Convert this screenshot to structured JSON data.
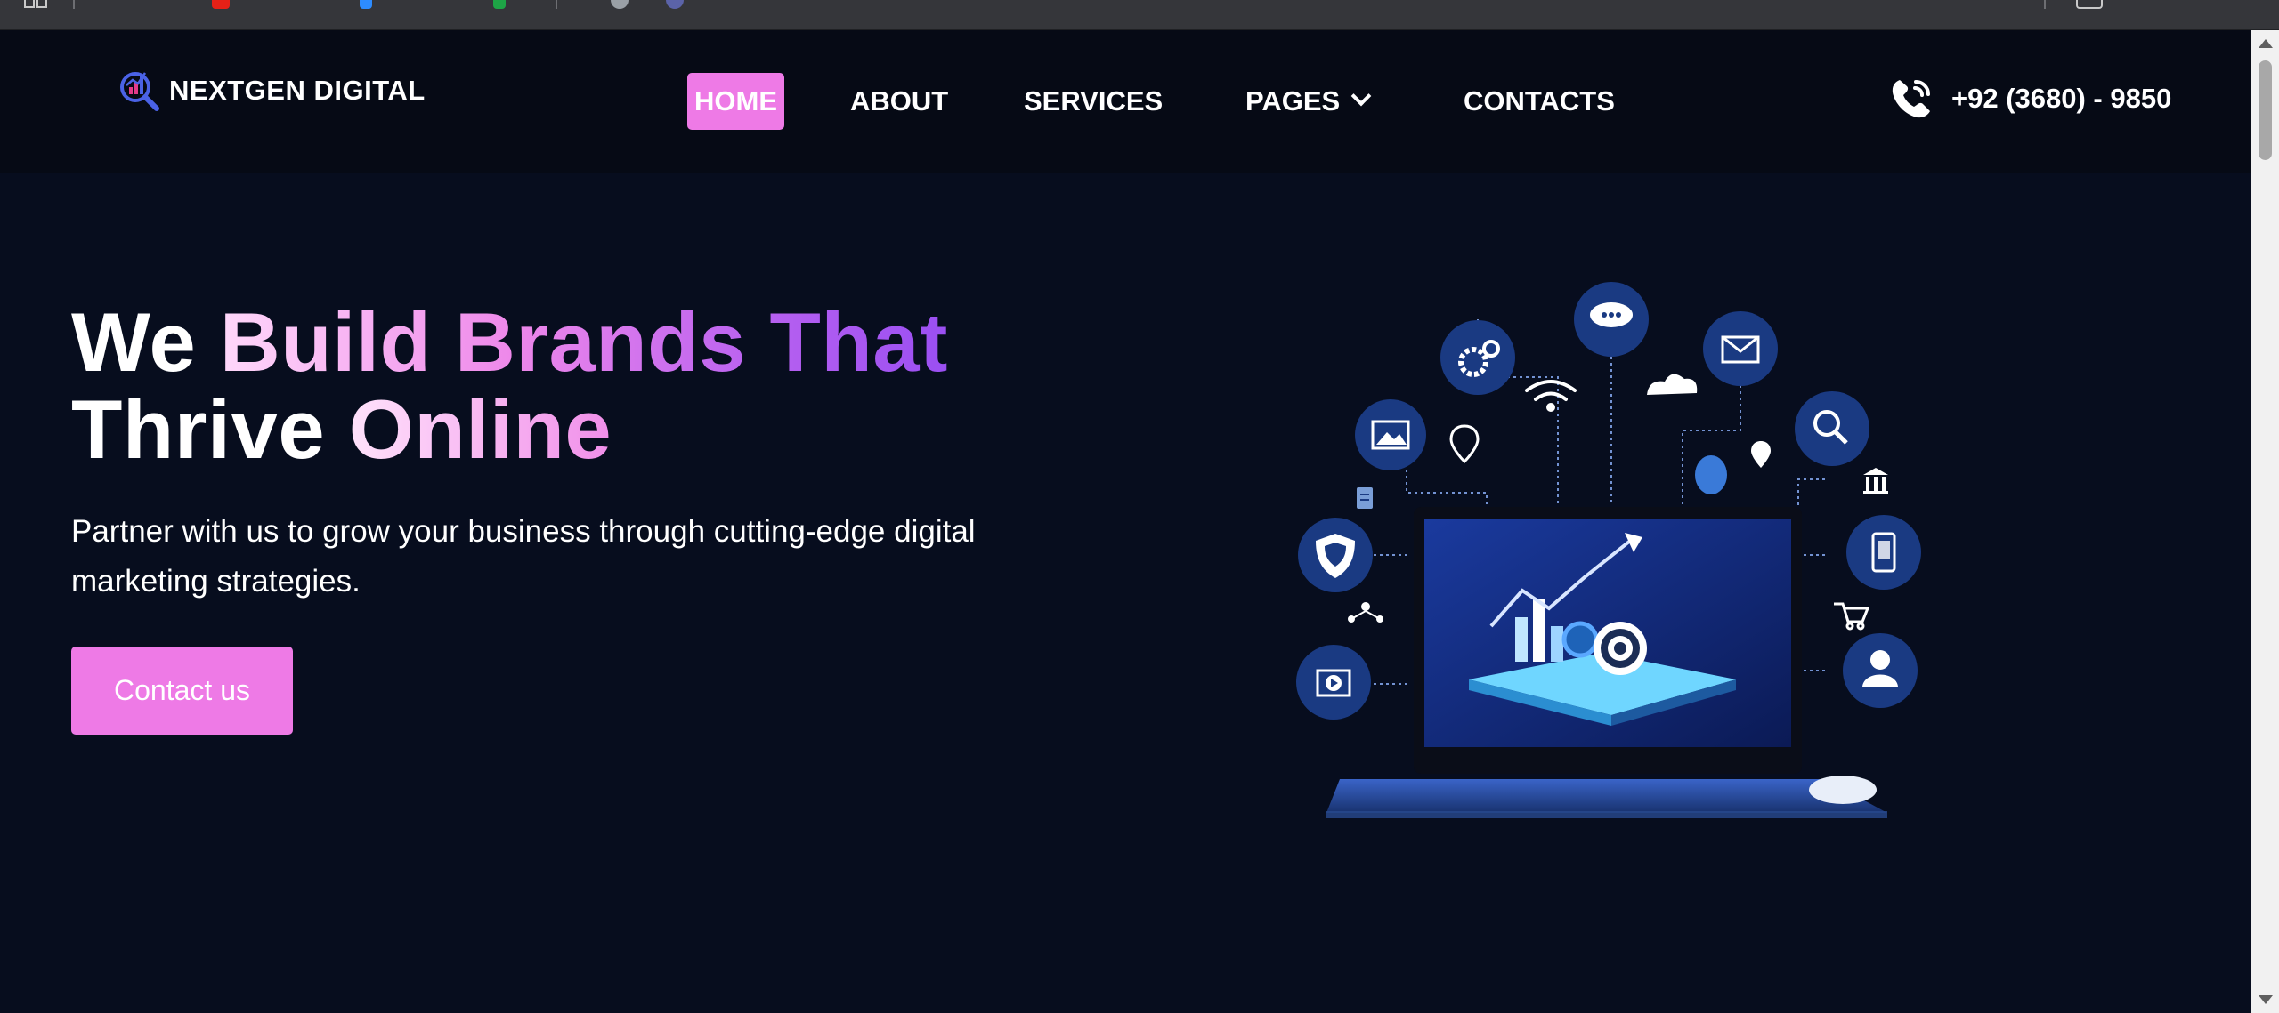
{
  "brand": {
    "name": "NEXTGEN DIGITAL",
    "accent": "#ee7ae6",
    "background": "#070d1e",
    "nav_background": "#060a15"
  },
  "nav": {
    "items": [
      {
        "label": "HOME",
        "active": true
      },
      {
        "label": "ABOUT",
        "active": false
      },
      {
        "label": "SERVICES",
        "active": false
      },
      {
        "label": "PAGES",
        "active": false,
        "has_dropdown": true
      },
      {
        "label": "CONTACTS",
        "active": false
      }
    ]
  },
  "contact": {
    "phone": "+92 (3680) - 9850",
    "icon": "phone-icon"
  },
  "hero": {
    "title_white_1": "We ",
    "title_gradient_1": "Build Brands That",
    "title_white_2": "Thrive ",
    "title_gradient_2": "Online",
    "subtitle": "Partner with us to grow your business through cutting-edge digital marketing strategies.",
    "cta_label": "Contact us"
  },
  "illustration": {
    "icons": [
      "gear-icon",
      "chat-icon",
      "mail-icon",
      "image-icon",
      "search-icon",
      "shield-icon",
      "mobile-icon",
      "video-icon",
      "user-icon",
      "wifi-icon",
      "cloud-icon",
      "location-icon",
      "bank-icon",
      "cart-icon",
      "document-icon"
    ]
  }
}
